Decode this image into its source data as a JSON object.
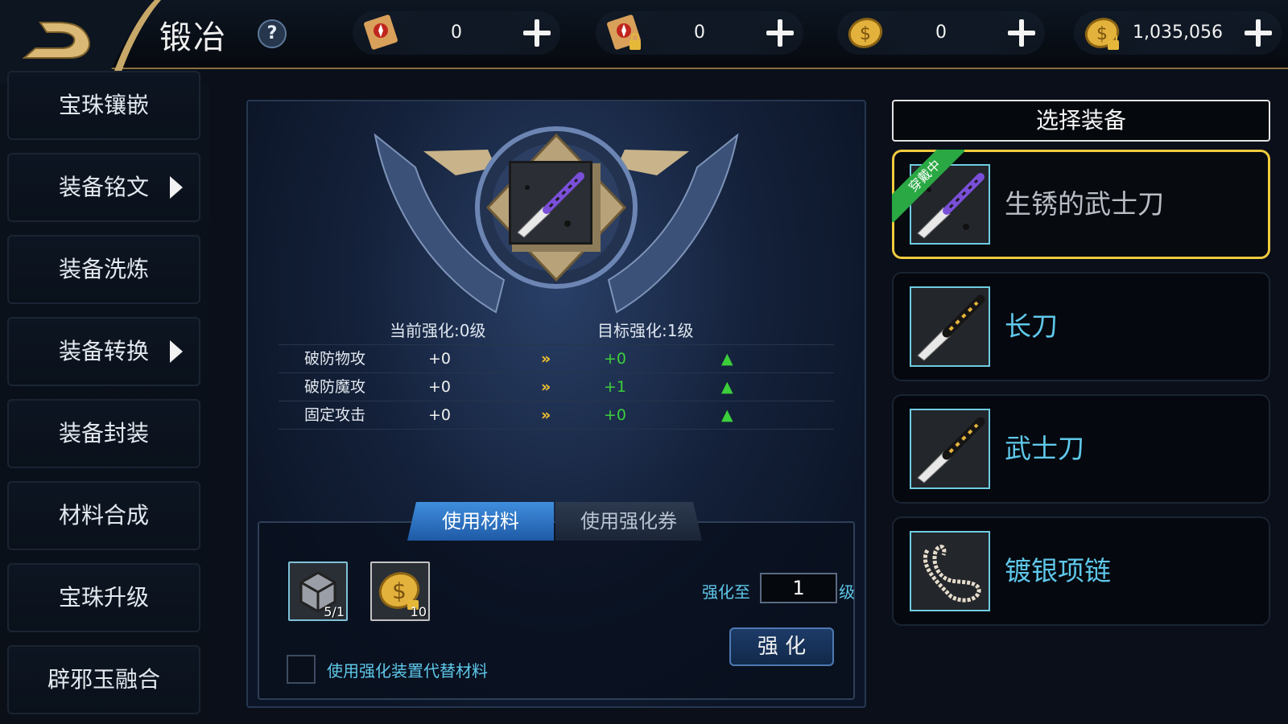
{
  "header": {
    "title": "锻冶",
    "help_label": "?",
    "currencies": [
      {
        "icon": "scroll-icon",
        "value": "0"
      },
      {
        "icon": "locked-scroll-icon",
        "value": "0"
      },
      {
        "icon": "coin-icon",
        "value": "0"
      },
      {
        "icon": "locked-coin-icon",
        "value": "1,035,056"
      }
    ]
  },
  "sidebar": {
    "items": [
      {
        "label": "宝珠镶嵌"
      },
      {
        "label": "装备铭文"
      },
      {
        "label": "装备洗炼"
      },
      {
        "label": "装备转换"
      },
      {
        "label": "装备封装"
      },
      {
        "label": "材料合成"
      },
      {
        "label": "宝珠升级"
      },
      {
        "label": "辟邪玉融合"
      }
    ]
  },
  "enhance": {
    "current_label": "当前强化:0级",
    "target_label": "目标强化:1级",
    "stats": [
      {
        "name": "破防物攻",
        "current": "+0",
        "target": "+0"
      },
      {
        "name": "破防魔攻",
        "current": "+0",
        "target": "+1"
      },
      {
        "name": "固定攻击",
        "current": "+0",
        "target": "+0"
      }
    ]
  },
  "materials": {
    "tab_materials": "使用材料",
    "tab_tickets": "使用强化券",
    "items": [
      {
        "icon": "cube-material-icon",
        "count": "5/1"
      },
      {
        "icon": "gold-coin-material-icon",
        "count": "10"
      }
    ],
    "enhance_to_label": "强化至",
    "level_value": "1",
    "level_unit": "级",
    "enhance_button": "强 化",
    "checkbox_label": "使用强化装置代替材料"
  },
  "equipment": {
    "title": "选择装备",
    "worn_badge": "穿戴中",
    "items": [
      {
        "name": "生锈的武士刀",
        "icon": "rusty-katana-icon"
      },
      {
        "name": "长刀",
        "icon": "long-blade-icon"
      },
      {
        "name": "武士刀",
        "icon": "katana-icon"
      },
      {
        "name": "镀银项链",
        "icon": "silver-necklace-icon"
      }
    ]
  },
  "colors": {
    "gold_border": "#f0cb3e",
    "cyan_text": "#5fc8ea",
    "green_up": "#3ccf3c"
  }
}
